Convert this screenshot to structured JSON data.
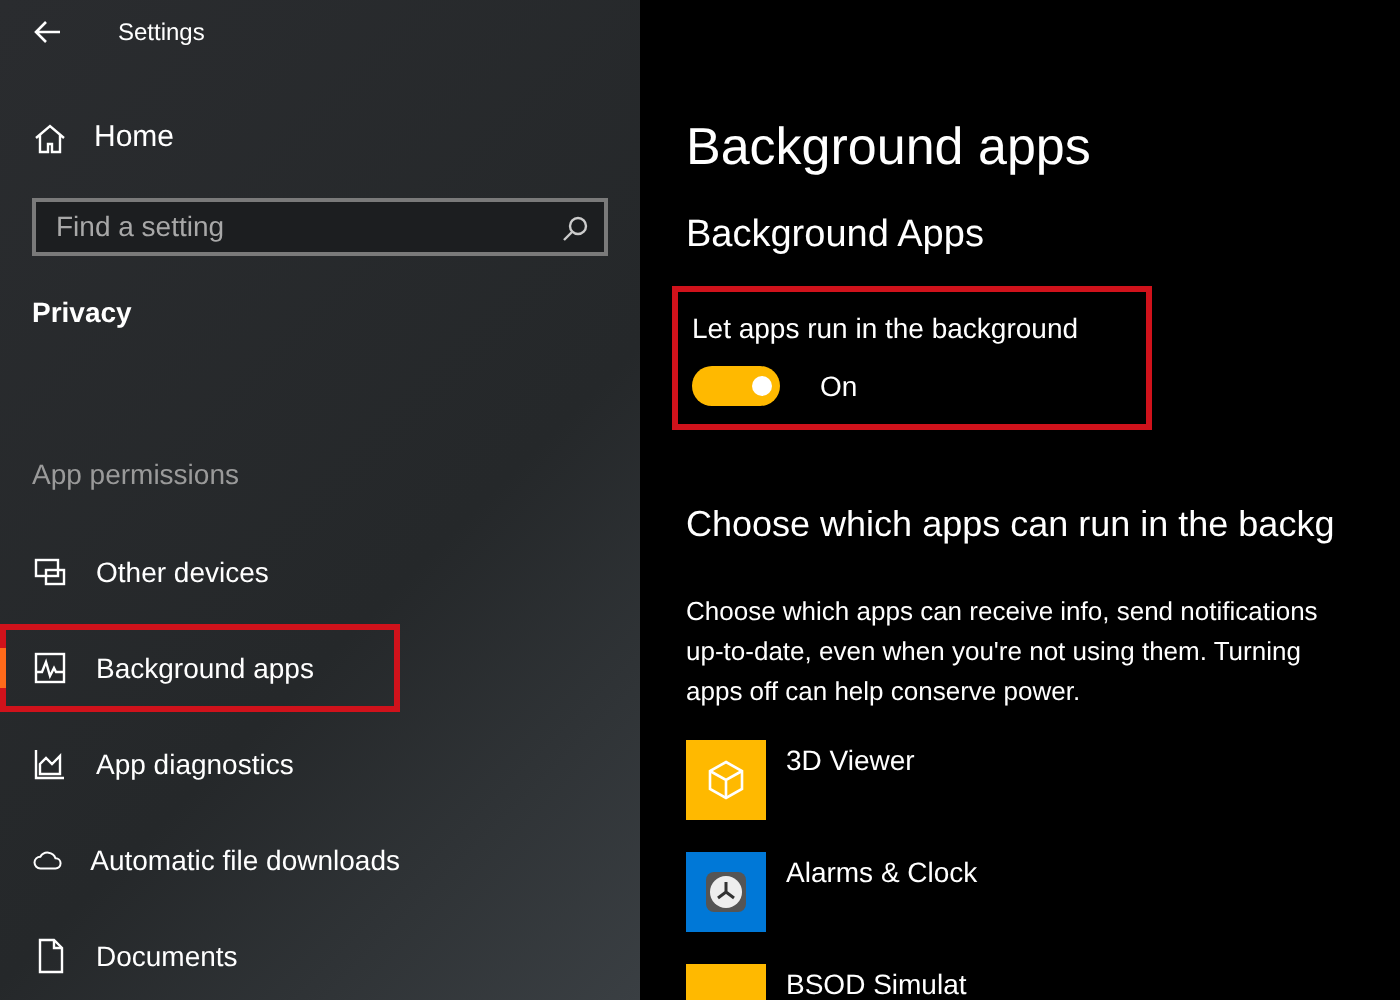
{
  "window": {
    "title": "Settings"
  },
  "sidebar": {
    "home": "Home",
    "search": {
      "placeholder": "Find a setting"
    },
    "category": "Privacy",
    "section": "App permissions",
    "items": [
      {
        "label": "Other devices",
        "kind": "devices",
        "selected": false,
        "highlighted": false
      },
      {
        "label": "Background apps",
        "kind": "activity",
        "selected": true,
        "highlighted": true
      },
      {
        "label": "App diagnostics",
        "kind": "chart",
        "selected": false,
        "highlighted": false
      },
      {
        "label": "Automatic file downloads",
        "kind": "cloud",
        "selected": false,
        "highlighted": false
      },
      {
        "label": "Documents",
        "kind": "document",
        "selected": false,
        "highlighted": false
      }
    ]
  },
  "main": {
    "title": "Background apps",
    "subtitle": "Background Apps",
    "toggle": {
      "label": "Let apps run in the background",
      "on": true,
      "state_text": "On",
      "highlighted": true
    },
    "section_title": "Choose which apps can run in the backg",
    "description": [
      "Choose which apps can receive info, send notifications",
      "up-to-date, even when you're not using them. Turning",
      "apps off can help conserve power."
    ],
    "apps": [
      {
        "name": "3D Viewer",
        "kind": "cube",
        "color": "#ffb900"
      },
      {
        "name": "Alarms & Clock",
        "kind": "clock",
        "color": "#0078d7"
      },
      {
        "name": "BSOD Simulat",
        "kind": "blank",
        "color": "#ffb900"
      }
    ]
  }
}
